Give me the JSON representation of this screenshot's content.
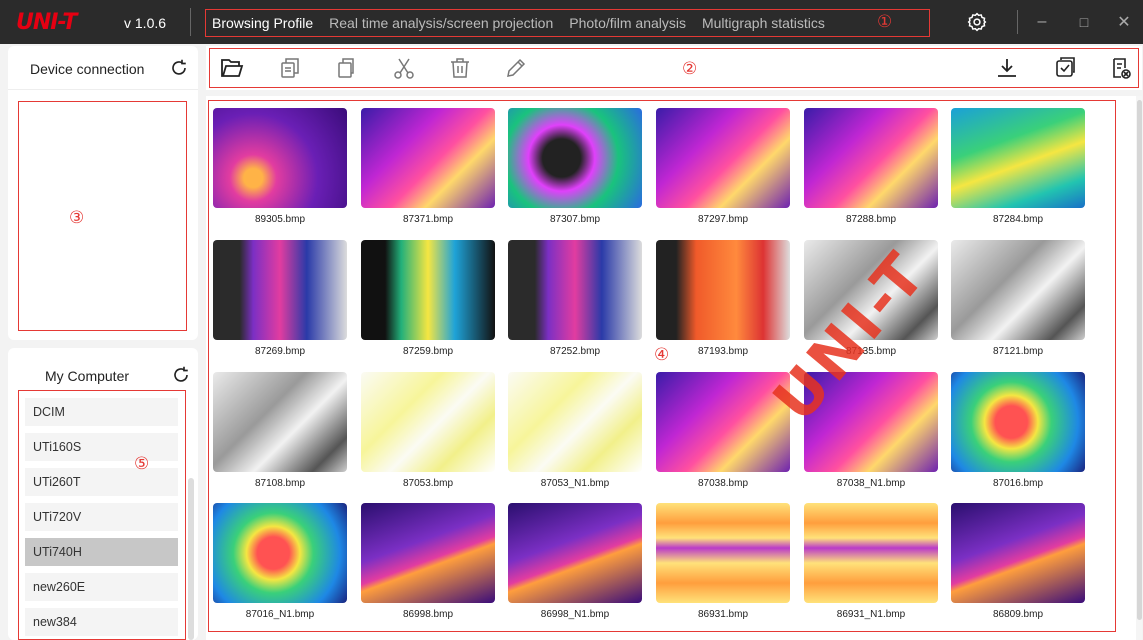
{
  "app": {
    "logo": "UNI-T",
    "version": "v 1.0.6"
  },
  "nav": {
    "tabs": [
      {
        "label": "Browsing Profile"
      },
      {
        "label": "Real time analysis/screen projection"
      },
      {
        "label": "Photo/film analysis"
      },
      {
        "label": "Multigraph statistics"
      }
    ]
  },
  "markers": {
    "m1": "①",
    "m2": "②",
    "m3": "③",
    "m4": "④",
    "m5": "⑤"
  },
  "window_controls": {
    "minimize": "–",
    "maximize": "□",
    "close": "✕"
  },
  "device_panel": {
    "title": "Device connection"
  },
  "computer_panel": {
    "title": "My Computer",
    "folders": [
      {
        "label": "DCIM"
      },
      {
        "label": "UTi160S"
      },
      {
        "label": "UTi260T"
      },
      {
        "label": "UTi720V"
      },
      {
        "label": "UTi740H",
        "selected": true
      },
      {
        "label": "new260E"
      },
      {
        "label": "new384"
      }
    ]
  },
  "toolbar": {
    "icons": [
      "folder-open-icon",
      "copy-icon",
      "duplicate-icon",
      "cut-icon",
      "delete-icon",
      "rename-icon",
      "download-icon",
      "select-all-icon",
      "clear-selection-icon"
    ]
  },
  "thumbnails": [
    {
      "file": "89305.bmp",
      "palette": "ironbow-dark"
    },
    {
      "file": "87371.bmp",
      "palette": "ironbow"
    },
    {
      "file": "87307.bmp",
      "palette": "rainbow-pink"
    },
    {
      "file": "87297.bmp",
      "palette": "ironbow"
    },
    {
      "file": "87288.bmp",
      "palette": "ironbow"
    },
    {
      "file": "87284.bmp",
      "palette": "rainbow"
    },
    {
      "file": "87269.bmp",
      "palette": "fusion"
    },
    {
      "file": "87259.bmp",
      "palette": "fusion-rainbow"
    },
    {
      "file": "87252.bmp",
      "palette": "fusion"
    },
    {
      "file": "87193.bmp",
      "palette": "fusion-red"
    },
    {
      "file": "87135.bmp",
      "palette": "grey"
    },
    {
      "file": "87121.bmp",
      "palette": "grey"
    },
    {
      "file": "87108.bmp",
      "palette": "grey"
    },
    {
      "file": "87053.bmp",
      "palette": "yellow-white"
    },
    {
      "file": "87053_N1.bmp",
      "palette": "yellow-white"
    },
    {
      "file": "87038.bmp",
      "palette": "ironbow"
    },
    {
      "file": "87038_N1.bmp",
      "palette": "ironbow"
    },
    {
      "file": "87016.bmp",
      "palette": "rainbow-person"
    },
    {
      "file": "87016_N1.bmp",
      "palette": "rainbow-person"
    },
    {
      "file": "86998.bmp",
      "palette": "ironbow-purple"
    },
    {
      "file": "86998_N1.bmp",
      "palette": "ironbow-purple"
    },
    {
      "file": "86931.bmp",
      "palette": "ironbow-hot"
    },
    {
      "file": "86931_N1.bmp",
      "palette": "ironbow-hot"
    },
    {
      "file": "86809.bmp",
      "palette": "ironbow-purple"
    }
  ],
  "watermark": "UNI-T",
  "colors": {
    "accent_red": "#e53935",
    "brand_red": "#e60012",
    "titlebar": "#2b2b2b"
  }
}
